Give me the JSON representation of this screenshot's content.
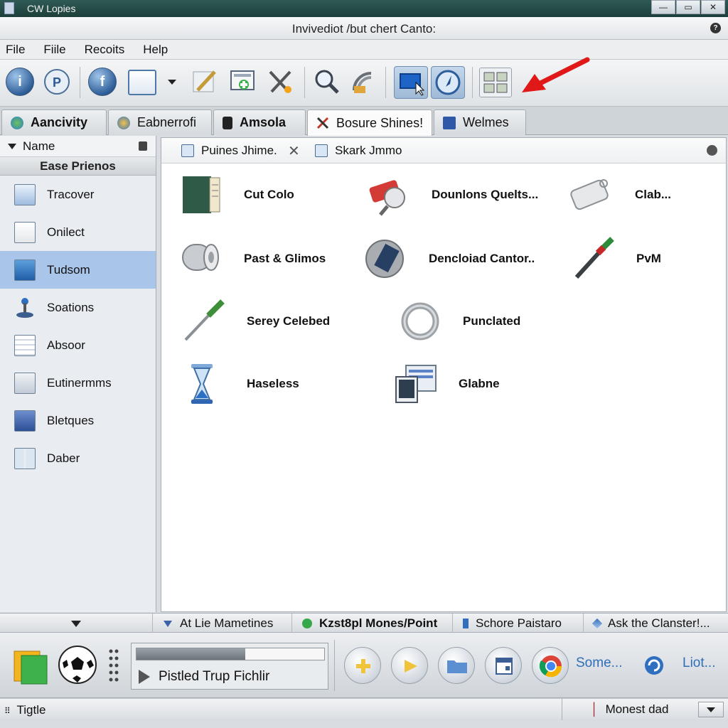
{
  "window": {
    "app_title": "CW Lopies",
    "document_title": "Invivediot /but chert Canto:",
    "controls": {
      "minimize": "—",
      "maximize": "▭",
      "close": "✕"
    }
  },
  "menu": [
    "File",
    "Fiile",
    "Recoits",
    "Help"
  ],
  "toolbar": {
    "buttons": [
      "info-icon",
      "p-icon",
      "f-globe-icon",
      "window-icon",
      "dropdown-arrow-icon",
      "pen-icon",
      "screen-add-icon",
      "tools-icon",
      "magnifier-icon",
      "signal-icon",
      "monitor-cursor-icon",
      "compass-icon",
      "grid-tiles-icon"
    ],
    "accent": "#e01818"
  },
  "tabs": [
    {
      "label": "Aancivity"
    },
    {
      "label": "Eabnerrofi"
    },
    {
      "label": "Amsola"
    },
    {
      "label": "Bosure Shines!"
    },
    {
      "label": "Welmes"
    }
  ],
  "sidebar": {
    "header": "Name",
    "subheader": "Ease Prienos",
    "items": [
      "Tracover",
      "Onilect",
      "Tudsom",
      "Soations",
      "Absoor",
      "Eutinermms",
      "Bletques",
      "Daber"
    ],
    "selected": "Tudsom",
    "selected_color": "#a9c5e9"
  },
  "content": {
    "tabs": [
      "Puines Jhime.",
      "Skark Jmmo"
    ],
    "items": [
      {
        "label": "Cut Colo",
        "icon": "book-icon"
      },
      {
        "label": "Dounlons Quelts...",
        "icon": "tag-tools-icon"
      },
      {
        "label": "Clab...",
        "icon": "label-tag-icon"
      },
      {
        "label": "Past & Glimos",
        "icon": "paper-roll-icon"
      },
      {
        "label": "Dencloiad Cantor..",
        "icon": "disc-icon"
      },
      {
        "label": "PvM",
        "icon": "marker-pen-icon"
      },
      {
        "label": "Serey Celebed",
        "icon": "screwdriver-icon"
      },
      {
        "label": "Punclated",
        "icon": "ring-icon"
      },
      {
        "label": "Haseless",
        "icon": "hourglass-icon"
      },
      {
        "label": "Glabne",
        "icon": "photo-gallery-icon"
      }
    ]
  },
  "statusbar": {
    "cells": [
      "At Lie Mametines",
      "Kzst8pl Mones/Point",
      "Schore Paistaro",
      "Ask the Clanster!..."
    ]
  },
  "player": {
    "progress": 0.58,
    "track": "Pistled Trup Fichlir",
    "links": [
      "Some...",
      "Liot..."
    ]
  },
  "bottom": {
    "left": "Tigtle",
    "right": "Monest dad",
    "right_prefix": "│"
  }
}
